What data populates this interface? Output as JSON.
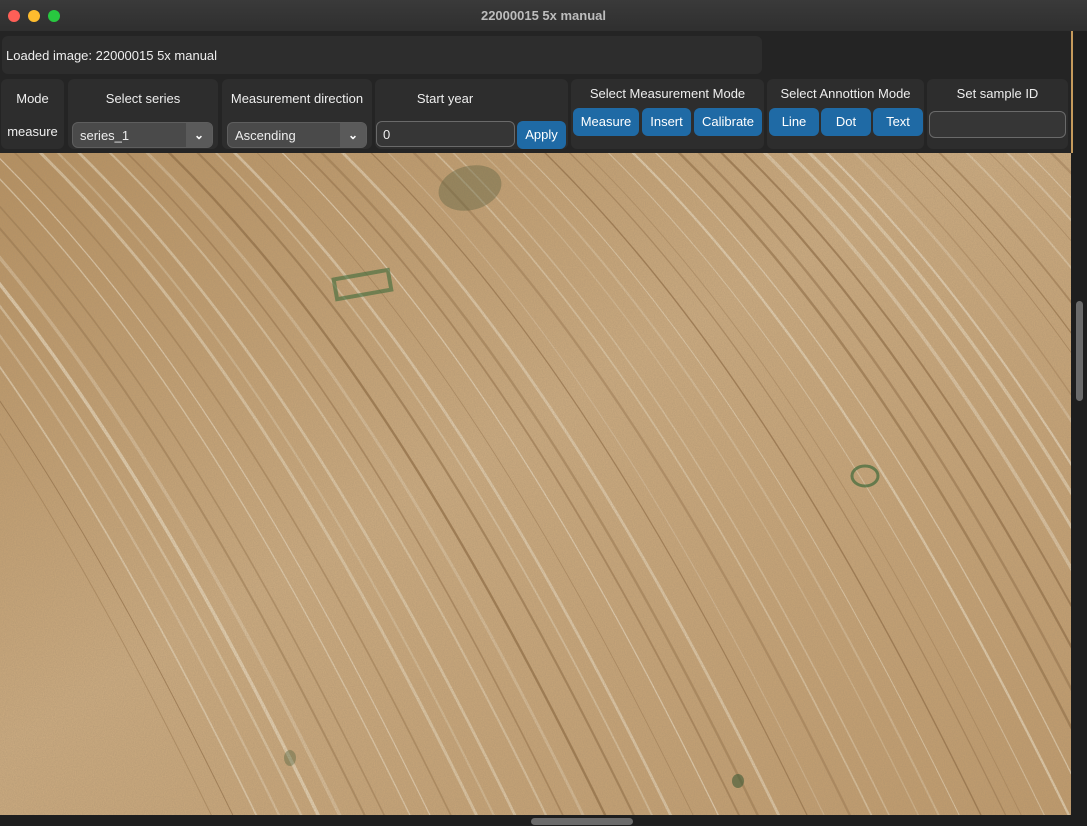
{
  "window": {
    "title": "22000015 5x manual"
  },
  "status": {
    "loaded_image": "Loaded image: 22000015 5x manual"
  },
  "mode": {
    "label": "Mode",
    "value": "measure"
  },
  "series": {
    "label": "Select series",
    "selected": "series_1"
  },
  "direction": {
    "label": "Measurement direction",
    "selected": "Ascending"
  },
  "start_year": {
    "label": "Start  year",
    "value": "0",
    "apply_label": "Apply"
  },
  "measurement_mode": {
    "label": "Select Measurement Mode",
    "buttons": [
      "Measure",
      "Insert",
      "Calibrate"
    ]
  },
  "annotation_mode": {
    "label": "Select Annottion Mode",
    "buttons": [
      "Line",
      "Dot",
      "Text"
    ]
  },
  "sample_id": {
    "label": "Set sample ID",
    "value": ""
  },
  "colors": {
    "accent": "#1f6aa5",
    "panel": "#2d2d2d",
    "background": "#242424",
    "wood_base": "#c7a377"
  },
  "icons": {
    "dropdown": "chevron-down-icon",
    "window_close": "close-icon",
    "window_minimize": "minimize-icon",
    "window_maximize": "maximize-icon"
  }
}
